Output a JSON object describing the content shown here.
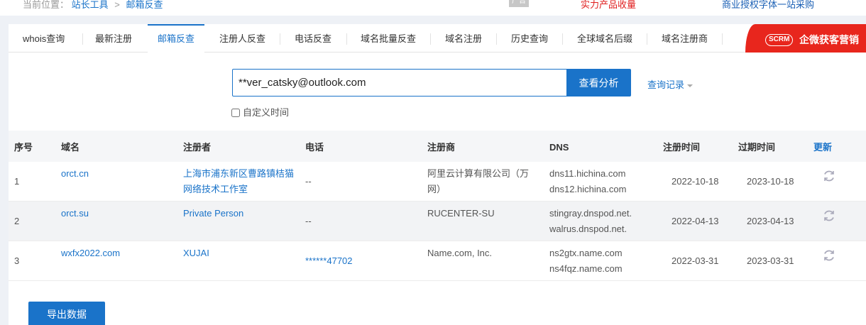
{
  "breadcrumb": {
    "prefix": "当前位置：",
    "items": [
      "站长工具",
      "邮箱反查"
    ],
    "separator": ">"
  },
  "ads": {
    "tag": "广告",
    "promo1": "实力产品收量",
    "promo2": "商业授权字体一站采购"
  },
  "tabs": [
    "whois查询",
    "最新注册",
    "邮箱反查",
    "注册人反查",
    "电话反查",
    "域名批量反查",
    "域名注册",
    "历史查询",
    "全球域名后缀",
    "域名注册商"
  ],
  "active_tab": "邮箱反查",
  "banner": {
    "badge": "SCRM",
    "text": "企微获客营销",
    "color": "#e8261d"
  },
  "search": {
    "value": "**ver_catsky@outlook.com",
    "button": "查看分析",
    "history": "查询记录"
  },
  "custom_time": {
    "label": "自定义时间",
    "checked": false
  },
  "table": {
    "headers": [
      "序号",
      "域名",
      "注册者",
      "电话",
      "注册商",
      "DNS",
      "注册时间",
      "过期时间",
      "更新"
    ],
    "rows": [
      {
        "no": "1",
        "domain": "orct.cn",
        "registrant_line1": "上海市浦东新区曹路镇桔猫",
        "registrant_line2": "网络技术工作室",
        "phone": "--",
        "registrar_line1": "阿里云计算有限公司（万",
        "registrar_line2": "网）",
        "dns1": "dns11.hichina.com",
        "dns2": "dns12.hichina.com",
        "reg_date": "2022-10-18",
        "exp_date": "2023-10-18"
      },
      {
        "no": "2",
        "domain": "orct.su",
        "registrant_line1": "Private Person",
        "registrant_line2": "",
        "phone": "--",
        "registrar_line1": "RUCENTER-SU",
        "registrar_line2": "",
        "dns1": "stingray.dnspod.net.",
        "dns2": "walrus.dnspod.net.",
        "reg_date": "2022-04-13",
        "exp_date": "2023-04-13"
      },
      {
        "no": "3",
        "domain": "wxfx2022.com",
        "registrant_line1": "XUJAI",
        "registrant_line2": "",
        "phone": "******47702",
        "registrar_line1": "Name.com, Inc.",
        "registrar_line2": "",
        "dns1": "ns2gtx.name.com",
        "dns2": "ns4fqz.name.com",
        "reg_date": "2022-03-31",
        "exp_date": "2023-03-31"
      }
    ]
  },
  "export_button": "导出数据",
  "colors": {
    "accent": "#1a73c9",
    "promo_red": "#e02020"
  }
}
